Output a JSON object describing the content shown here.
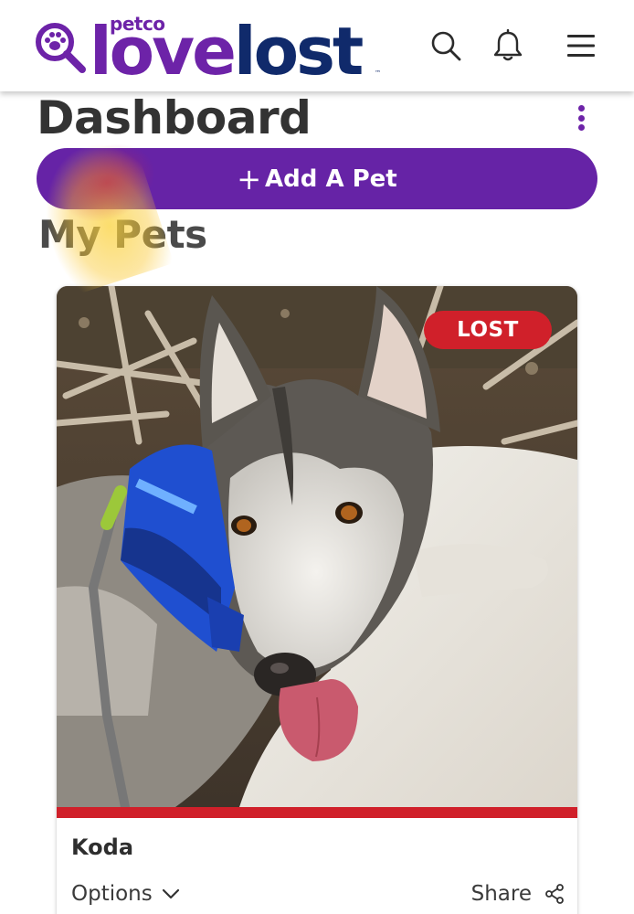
{
  "header": {
    "brand_small": "petco",
    "brand_love": "love",
    "brand_lost": "lost",
    "brand_tm": "™",
    "icons": [
      "paw-magnifier-icon",
      "search-icon",
      "bell-icon",
      "hamburger-menu-icon"
    ]
  },
  "page": {
    "title": "Dashboard",
    "add_pet_plus": "+",
    "add_pet_label": "Add A Pet",
    "section_title": "My Pets"
  },
  "pets": [
    {
      "name": "Koda",
      "status": "LOST",
      "options_label": "Options",
      "share_label": "Share"
    }
  ],
  "colors": {
    "brand_purple": "#6623a6",
    "brand_navy": "#102a6b",
    "lost_red": "#d0202a"
  }
}
